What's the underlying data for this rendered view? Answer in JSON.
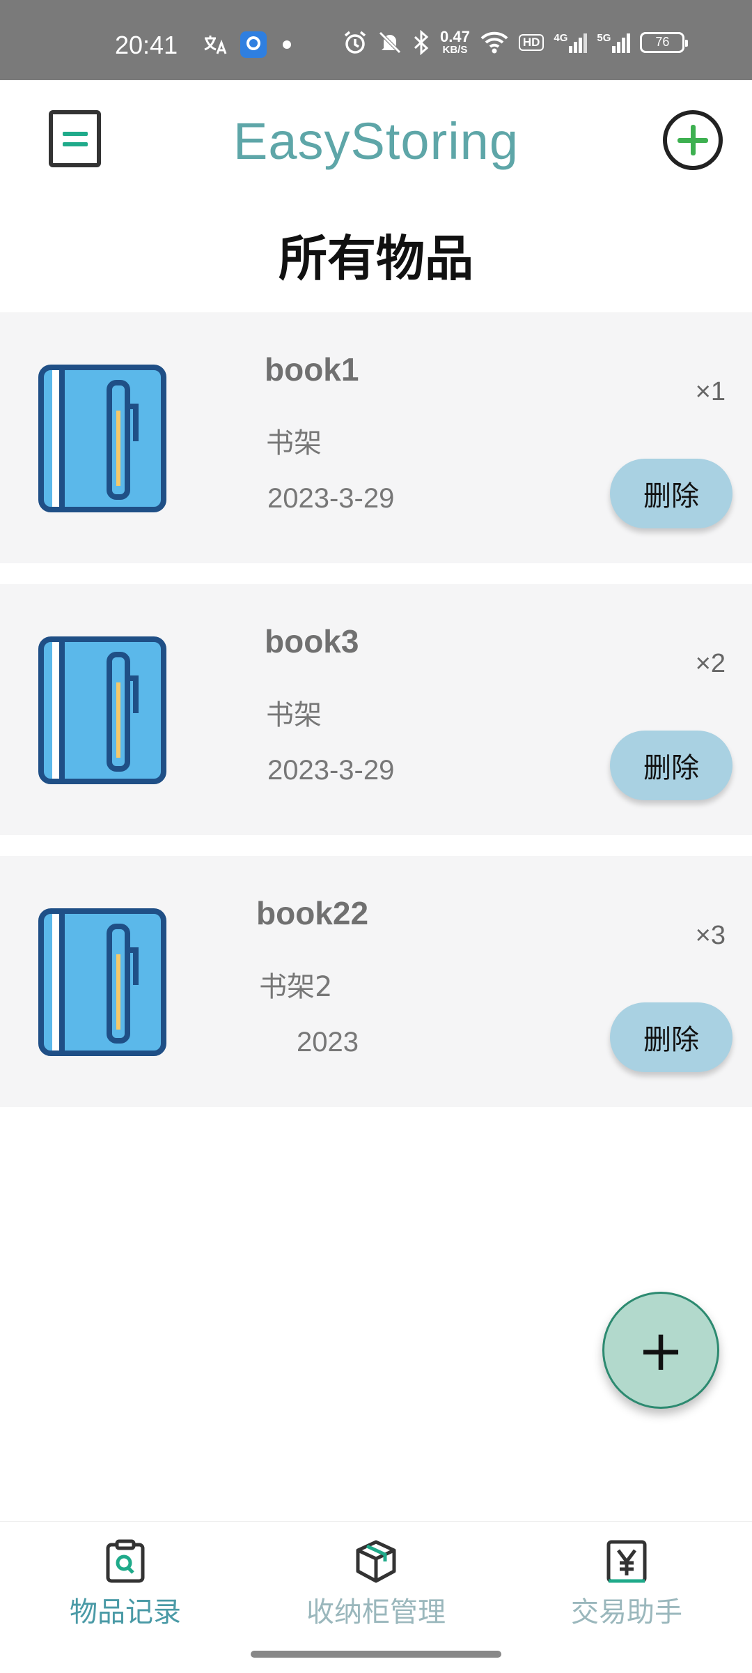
{
  "status_bar": {
    "time": "20:41",
    "net_speed_value": "0.47",
    "net_speed_unit": "KB/S",
    "hd_badge": "HD",
    "signal_1": "4G",
    "signal_2": "5G",
    "battery": "76"
  },
  "header": {
    "app_title": "EasyStoring",
    "page_title": "所有物品"
  },
  "items": [
    {
      "name": "book1",
      "location": "书架",
      "date": "2023-3-29",
      "quantity": "×1",
      "delete_label": "删除",
      "icon": "book-icon"
    },
    {
      "name": "book3",
      "location": "书架",
      "date": "2023-3-29",
      "quantity": "×2",
      "delete_label": "删除",
      "icon": "book-icon"
    },
    {
      "name": "book22",
      "location": "书架2",
      "date": "2023",
      "quantity": "×3",
      "delete_label": "删除",
      "icon": "book-icon"
    }
  ],
  "fab": {
    "label": "+"
  },
  "bottom_nav": [
    {
      "label": "物品记录",
      "icon": "clipboard-search-icon",
      "active": true
    },
    {
      "label": "收纳柜管理",
      "icon": "box-icon",
      "active": false
    },
    {
      "label": "交易助手",
      "icon": "yen-icon",
      "active": false
    }
  ],
  "colors": {
    "accent": "#5ea6a8",
    "card_bg": "#f5f5f6",
    "delete_button": "#a9d1e2",
    "fab_bg": "#b2d9cc",
    "add_icon_green": "#3db050"
  }
}
